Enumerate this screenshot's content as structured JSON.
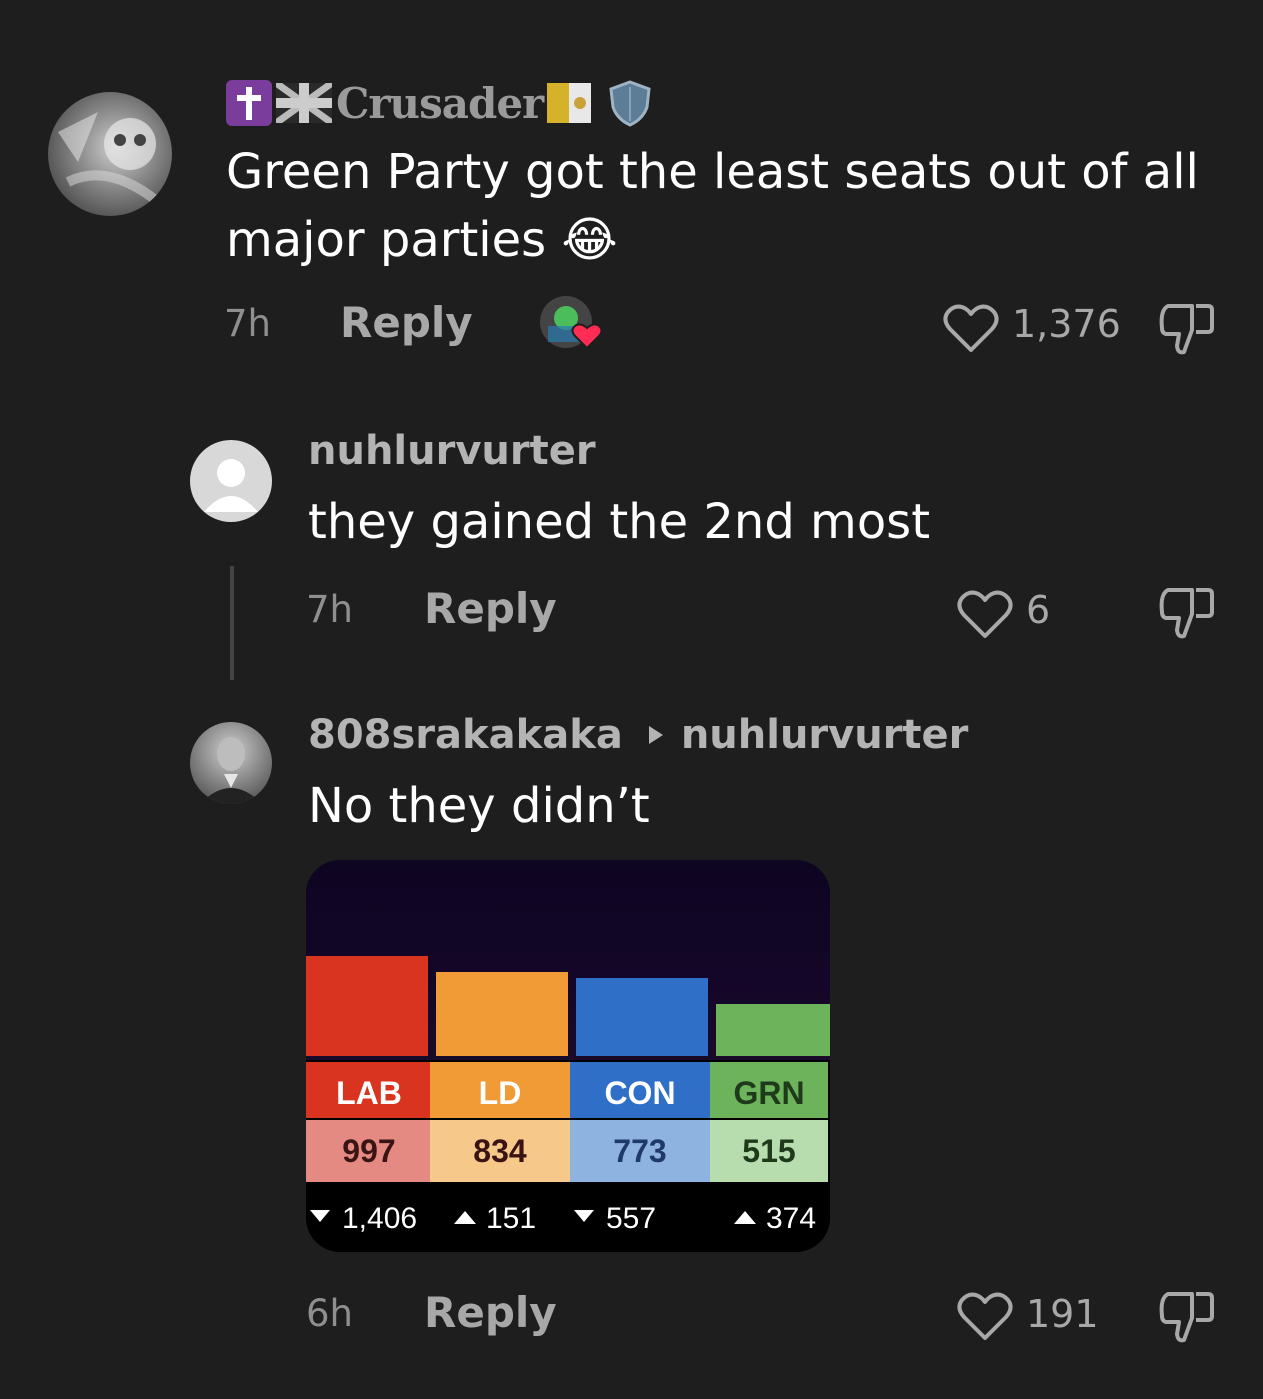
{
  "comments": [
    {
      "username": "Crusader",
      "text_line1": "Green Party got the least seats out of all",
      "text_line2": "major parties",
      "emoji": "😂",
      "time": "7h",
      "reply_label": "Reply",
      "likes": "1,376"
    },
    {
      "username": "nuhlurvurter",
      "text": "they gained the 2nd most",
      "time": "7h",
      "reply_label": "Reply",
      "likes": "6"
    },
    {
      "username": "808srakakaka",
      "reply_to": "nuhlurvurter",
      "text": "No they didn’t",
      "time": "6h",
      "reply_label": "Reply",
      "likes": "191"
    }
  ],
  "chart_data": {
    "type": "bar",
    "categories": [
      "LAB",
      "LD",
      "CON",
      "GRN"
    ],
    "values": [
      997,
      834,
      773,
      515
    ],
    "changes": [
      {
        "direction": "down",
        "text": "1,406"
      },
      {
        "direction": "up",
        "text": "151"
      },
      {
        "direction": "down",
        "text": "557"
      },
      {
        "direction": "up",
        "text": "374"
      }
    ],
    "colors": [
      "#d9341f",
      "#f09b35",
      "#2f6fc8",
      "#6cb35c"
    ],
    "label_bg": [
      "#d9341f",
      "#f09b35",
      "#2f6fc8",
      "#6cb35c"
    ],
    "value_bg": [
      "#e48a83",
      "#f6c98a",
      "#8fb3e0",
      "#b7dcae"
    ]
  },
  "icons": {
    "like": "heart-icon",
    "dislike": "thumbs-down-icon",
    "reply_arrow": "triangle-right-icon"
  }
}
